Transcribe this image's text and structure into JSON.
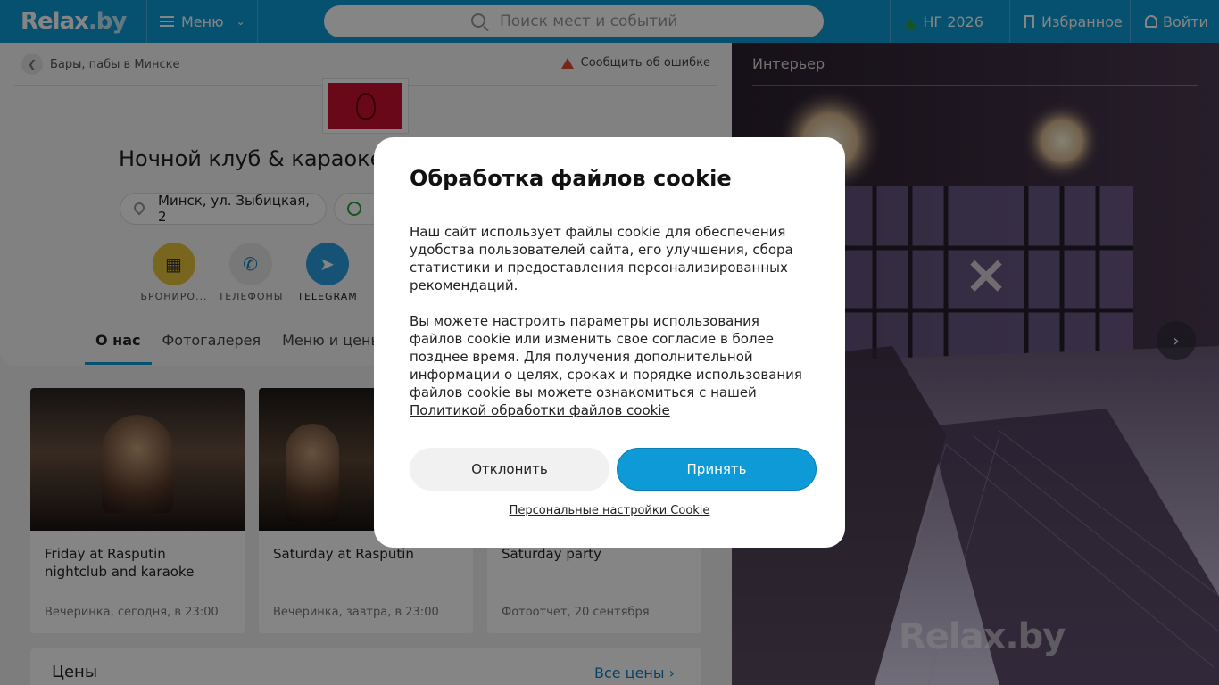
{
  "header": {
    "logo_main": "Relax",
    "logo_suffix": ".by",
    "menu_label": "Меню",
    "search_placeholder": "Поиск мест и событий",
    "ng_label": "НГ 2026",
    "favorites_label": "Избранное",
    "login_label": "Войти"
  },
  "breadcrumb": {
    "label": "Бары, пабы в Минске"
  },
  "report_error": "Сообщить об ошибке",
  "venue": {
    "title": "Ночной клуб & караоке",
    "address": "Минск, ул. Зыбицкая, 2"
  },
  "actions": [
    {
      "label": "БРОНИРО...",
      "icon": "calendar-icon",
      "color": "#e8c33a"
    },
    {
      "label": "ТЕЛЕФОНЫ",
      "icon": "phone-icon",
      "color": "#e6e6e6"
    },
    {
      "label": "TELEGRAM",
      "icon": "telegram-icon",
      "color": "#2a9de0"
    }
  ],
  "tabs": [
    {
      "label": "О нас",
      "active": true
    },
    {
      "label": "Фотогалерея",
      "active": false
    },
    {
      "label": "Меню и цены",
      "active": false
    }
  ],
  "events": [
    {
      "title": "Friday at Rasputin nightclub and karaoke",
      "meta": "Вечеринка, сегодня, в 23:00"
    },
    {
      "title": "Saturday at Rasputin",
      "meta": "Вечеринка, завтра, в 23:00"
    },
    {
      "title": "Saturday party",
      "meta": "Фотоотчет, 20 сентября"
    }
  ],
  "prices": {
    "title": "Цены",
    "link": "Все цены"
  },
  "gallery": {
    "label": "Интерьер",
    "watermark": "Relax.by"
  },
  "cookie": {
    "title": "Обработка файлов cookie",
    "p1": "Наш сайт использует файлы cookie для обеспечения удобства пользователей сайта, его улучшения, сбора статистики и предоставления персонализированных рекомендаций.",
    "p2": "Вы можете настроить параметры использования файлов cookie или изменить свое согласие в более позднее время. Для получения дополнительной информации о целях, сроках и порядке использования файлов cookie вы можете ознакомиться с нашей",
    "policy_link": "Политикой обработки файлов cookie",
    "decline": "Отклонить",
    "accept": "Принять",
    "personal": "Персональные настройки Cookie"
  }
}
